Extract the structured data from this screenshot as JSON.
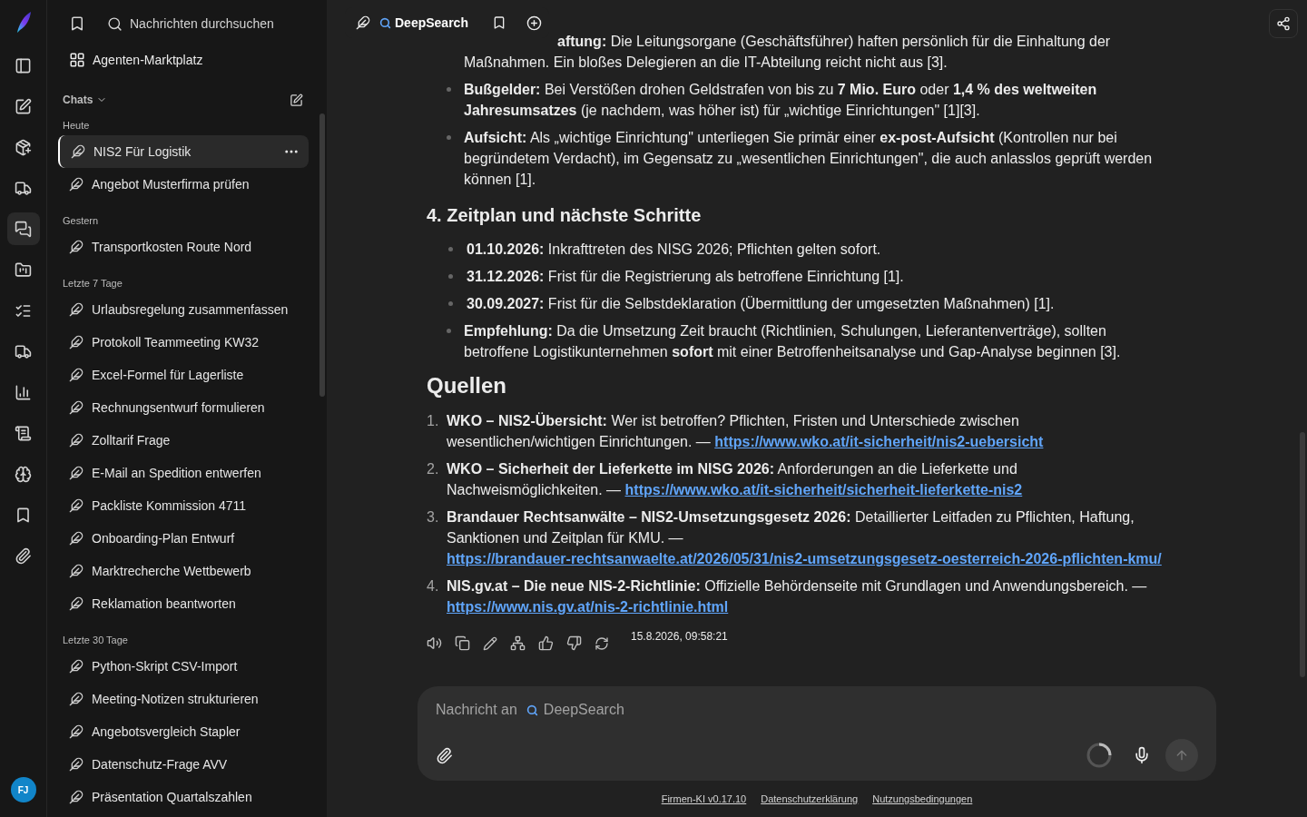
{
  "rail": {
    "items": [
      {
        "selected": false
      },
      {
        "selected": false
      },
      {
        "selected": false
      },
      {
        "selected": false
      },
      {
        "selected": true
      },
      {
        "selected": false
      },
      {
        "selected": false
      },
      {
        "selected": false
      },
      {
        "selected": false
      },
      {
        "selected": false
      },
      {
        "selected": false
      },
      {
        "selected": false
      },
      {
        "selected": false
      }
    ],
    "avatar": "FJ"
  },
  "sidebar": {
    "search_placeholder": "Nachrichten durchsuchen",
    "marketplace": "Agenten-Marktplatz",
    "chats_label": "Chats",
    "groups": [
      {
        "label": "Heute",
        "items": [
          {
            "title": "NIS2 Für Logistik",
            "selected": true
          },
          {
            "title": "Angebot Musterfirma prüfen",
            "selected": false
          }
        ]
      },
      {
        "label": "Gestern",
        "items": [
          {
            "title": "Transportkosten Route Nord",
            "selected": false
          }
        ]
      },
      {
        "label": "Letzte 7 Tage",
        "items": [
          {
            "title": "Urlaubsregelung zusammenfassen",
            "selected": false
          },
          {
            "title": "Protokoll Teammeeting KW32",
            "selected": false
          },
          {
            "title": "Excel-Formel für Lagerliste",
            "selected": false
          },
          {
            "title": "Rechnungsentwurf formulieren",
            "selected": false
          },
          {
            "title": "Zolltarif Frage",
            "selected": false
          },
          {
            "title": "E-Mail an Spedition entwerfen",
            "selected": false
          },
          {
            "title": "Packliste Kommission 4711",
            "selected": false
          },
          {
            "title": "Onboarding-Plan Entwurf",
            "selected": false
          },
          {
            "title": "Marktrecherche Wettbewerb",
            "selected": false
          },
          {
            "title": "Reklamation beantworten",
            "selected": false
          }
        ]
      },
      {
        "label": "Letzte 30 Tage",
        "items": [
          {
            "title": "Python-Skript CSV-Import",
            "selected": false
          },
          {
            "title": "Meeting-Notizen strukturieren",
            "selected": false
          },
          {
            "title": "Angebotsvergleich Stapler",
            "selected": false
          },
          {
            "title": "Datenschutz-Frage AVV",
            "selected": false
          },
          {
            "title": "Präsentation Quartalszahlen",
            "selected": false
          }
        ]
      }
    ]
  },
  "header": {
    "agent": "DeepSearch"
  },
  "message": {
    "top_bullets": [
      "**aftung:** Die Leitungsorgane (Geschäftsführer) haften persönlich für die Einhaltung der Maßnahmen. Ein bloßes Delegieren an die IT-Abteilung reicht nicht aus [3].",
      "**Bußgelder:** Bei Verstößen drohen Geldstrafen von bis zu **7 Mio. Euro** oder **1,4 % des weltweiten Jahresumsatzes** (je nachdem, was höher ist) für „wichtige Einrichtungen\" [1][3].",
      "**Aufsicht:** Als „wichtige Einrichtung\" unterliegen Sie primär einer **ex-post-Aufsicht** (Kontrollen nur bei begründetem Verdacht), im Gegensatz zu „wesentlichen Einrichtungen\", die auch anlasslos geprüft werden können [1]."
    ],
    "section_heading": "4. Zeitplan und nächste Schritte",
    "timeline": [
      "**01.10.2026:** Inkrafttreten des NISG 2026; Pflichten gelten sofort.",
      "**31.12.2026:** Frist für die Registrierung als betroffene Einrichtung [1].",
      "**30.09.2027:** Frist für die Selbstdeklaration (Übermittlung der umgesetzten Maßnahmen) [1].",
      "**Empfehlung:** Da die Umsetzung Zeit braucht (Richtlinien, Schulungen, Lieferantenverträge), sollten betroffene Logistikunternehmen **sofort** mit einer Betroffenheitsanalyse und Gap-Analyse beginnen [3]."
    ],
    "sources_heading": "Quellen",
    "sources": [
      {
        "number": "1.",
        "title": "WKO – NIS2-Übersicht:",
        "text": "Wer ist betroffen? Pflichten, Fristen und Unterschiede zwischen wesentlichen/wichtigen Einrichtungen. —",
        "link": "https://www.wko.at/it-sicherheit/nis2-uebersicht"
      },
      {
        "number": "2.",
        "title": "WKO – Sicherheit der Lieferkette im NISG 2026:",
        "text": "Anforderungen an die Lieferkette und Nachweismöglichkeiten. —",
        "link": "https://www.wko.at/it-sicherheit/sicherheit-lieferkette-nis2"
      },
      {
        "number": "3.",
        "title": "Brandauer Rechtsanwälte – NIS2-Umsetzungsgesetz 2026:",
        "text": "Detaillierter Leitfaden zu Pflichten, Haftung, Sanktionen und Zeitplan für KMU. —",
        "link": "https://brandauer-rechtsanwaelte.at/2026/05/31/nis2-umsetzungsgesetz-oesterreich-2026-pflichten-kmu/"
      },
      {
        "number": "4.",
        "title": "NIS.gv.at – Die neue NIS-2-Richtlinie:",
        "text": "Offizielle Behördenseite mit Grundlagen und Anwendungsbereich. —",
        "link": "https://www.nis.gv.at/nis-2-richtlinie.html"
      }
    ],
    "timestamp": "15.8.2026, 09:58:21"
  },
  "composer": {
    "placeholder": "Nachricht an",
    "agent": "DeepSearch"
  },
  "footer": {
    "links": [
      "Firmen-KI v0.17.10",
      "Datenschutzerklärung",
      "Nutzungsbedingungen"
    ]
  }
}
